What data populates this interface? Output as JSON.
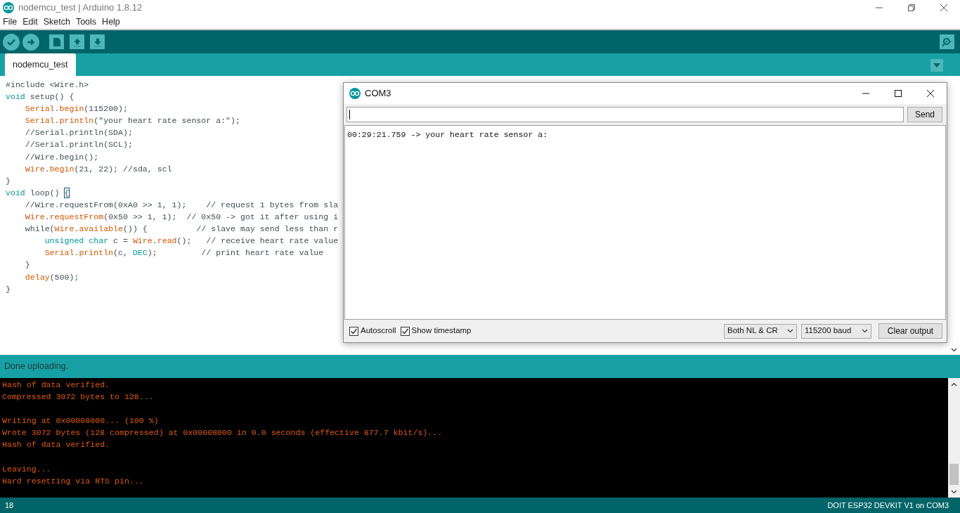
{
  "window": {
    "title": "nodemcu_test | Arduino 1.8.12"
  },
  "menu": [
    "File",
    "Edit",
    "Sketch",
    "Tools",
    "Help"
  ],
  "tabs": [
    {
      "label": "nodemcu_test",
      "selected": true
    }
  ],
  "code": [
    {
      "tokens": [
        {
          "kind": "plain",
          "text": "#include <Wire.h>"
        }
      ]
    },
    {
      "tokens": [
        {
          "kind": "kw",
          "text": "void"
        },
        {
          "kind": "plain",
          "text": " setup() {"
        }
      ]
    },
    {
      "tokens": [
        {
          "kind": "fn",
          "text": "    Serial"
        },
        {
          "kind": "plain",
          "text": "."
        },
        {
          "kind": "fn",
          "text": "begin"
        },
        {
          "kind": "plain",
          "text": "(115200);"
        }
      ]
    },
    {
      "tokens": [
        {
          "kind": "fn",
          "text": "    Serial"
        },
        {
          "kind": "plain",
          "text": "."
        },
        {
          "kind": "fn",
          "text": "println"
        },
        {
          "kind": "plain",
          "text": "(\"your heart rate sensor a:\");"
        }
      ]
    },
    {
      "tokens": [
        {
          "kind": "plain",
          "text": "    //Serial.println(SDA);"
        }
      ]
    },
    {
      "tokens": [
        {
          "kind": "plain",
          "text": "    //Serial.println(SCL);"
        }
      ]
    },
    {
      "tokens": [
        {
          "kind": "plain",
          "text": "    //Wire.begin();"
        }
      ]
    },
    {
      "tokens": [
        {
          "kind": "fn",
          "text": "    Wire"
        },
        {
          "kind": "plain",
          "text": "."
        },
        {
          "kind": "fn",
          "text": "begin"
        },
        {
          "kind": "plain",
          "text": "(21, 22); //sda, scl"
        }
      ]
    },
    {
      "tokens": [
        {
          "kind": "plain",
          "text": "}"
        }
      ]
    },
    {
      "tokens": [
        {
          "kind": "kw",
          "text": "void"
        },
        {
          "kind": "plain",
          "text": " loop() "
        },
        {
          "kind": "match",
          "text": "{"
        }
      ]
    },
    {
      "tokens": [
        {
          "kind": "plain",
          "text": "    //Wire.requestFrom(0xA0 >> 1, 1);    // request 1 bytes from sla"
        }
      ]
    },
    {
      "tokens": [
        {
          "kind": "fn",
          "text": "    Wire"
        },
        {
          "kind": "plain",
          "text": "."
        },
        {
          "kind": "fn",
          "text": "requestFrom"
        },
        {
          "kind": "plain",
          "text": "(0x50 >> 1, 1);  // 0x50 -> got it after using i"
        }
      ]
    },
    {
      "tokens": [
        {
          "kind": "plain",
          "text": "    while("
        },
        {
          "kind": "fn",
          "text": "Wire"
        },
        {
          "kind": "plain",
          "text": "."
        },
        {
          "kind": "fn",
          "text": "available"
        },
        {
          "kind": "plain",
          "text": "()) {          // slave may send less than r"
        }
      ]
    },
    {
      "tokens": [
        {
          "kind": "kw",
          "text": "        unsigned char"
        },
        {
          "kind": "plain",
          "text": " c = "
        },
        {
          "kind": "fn",
          "text": "Wire"
        },
        {
          "kind": "plain",
          "text": "."
        },
        {
          "kind": "fn",
          "text": "read"
        },
        {
          "kind": "plain",
          "text": "();   // receive heart rate value"
        }
      ]
    },
    {
      "tokens": [
        {
          "kind": "fn",
          "text": "        Serial"
        },
        {
          "kind": "plain",
          "text": "."
        },
        {
          "kind": "fn",
          "text": "println"
        },
        {
          "kind": "plain",
          "text": "(c, "
        },
        {
          "kind": "kw",
          "text": "DEC"
        },
        {
          "kind": "plain",
          "text": ");         // print heart rate value"
        }
      ]
    },
    {
      "tokens": [
        {
          "kind": "plain",
          "text": "    }"
        }
      ]
    },
    {
      "tokens": [
        {
          "kind": "fn",
          "text": "    delay"
        },
        {
          "kind": "plain",
          "text": "(500);"
        }
      ]
    },
    {
      "tokens": [
        {
          "kind": "plain",
          "text": "}"
        }
      ]
    }
  ],
  "status": "Done uploading.",
  "console": [
    {
      "kind": "text",
      "text": "Hash of data verified."
    },
    {
      "kind": "text",
      "text": "Compressed 3072 bytes to 128..."
    },
    {
      "kind": "blank"
    },
    {
      "kind": "text",
      "text": "Writing at 0x00008000... (100 %)"
    },
    {
      "kind": "text",
      "text": "Wrote 3072 bytes (128 compressed) at 0x00008000 in 0.0 seconds (effective 877.7 kbit/s)..."
    },
    {
      "kind": "text",
      "text": "Hash of data verified."
    },
    {
      "kind": "blank"
    },
    {
      "kind": "text",
      "text": "Leaving..."
    },
    {
      "kind": "text",
      "text": "Hard resetting via RTS pin..."
    }
  ],
  "footer": {
    "line": "18",
    "board": "DOIT ESP32 DEVKIT V1 on COM3"
  },
  "serial_monitor": {
    "title": "COM3",
    "send": "Send",
    "output": [
      "00:29:21.759 -> your heart rate sensor a:"
    ],
    "options": [
      {
        "label": "Autoscroll",
        "checked": true
      },
      {
        "label": "Show timestamp",
        "checked": true
      }
    ],
    "line_ending": "Both NL & CR",
    "baud": "115200 baud",
    "clear": "Clear output"
  }
}
